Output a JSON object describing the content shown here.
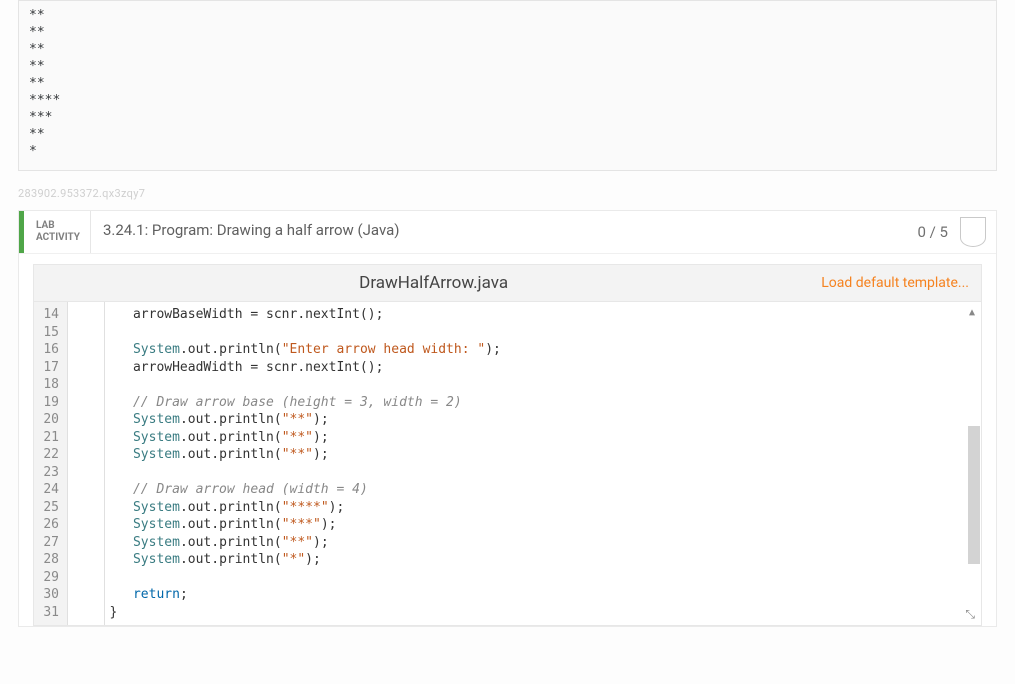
{
  "output": [
    "**",
    "**",
    "**",
    "**",
    "**",
    "****",
    "***",
    "**",
    "*"
  ],
  "hash": "283902.953372.qx3zqy7",
  "lab": {
    "tag_line1": "LAB",
    "tag_line2": "ACTIVITY",
    "title": "3.24.1: Program: Drawing a half arrow (Java)",
    "score": "0 / 5"
  },
  "editor": {
    "filename": "DrawHalfArrow.java",
    "load_template": "Load default template...",
    "first_line_number": 14,
    "lines": [
      {
        "n": 14,
        "html": "      arrowBaseWidth = scnr.nextInt();"
      },
      {
        "n": 15,
        "html": ""
      },
      {
        "n": 16,
        "html": "      <span class='cls'>System</span>.out.println(<span class='str'>\"Enter arrow head width: \"</span>);"
      },
      {
        "n": 17,
        "html": "      arrowHeadWidth = scnr.nextInt();"
      },
      {
        "n": 18,
        "html": ""
      },
      {
        "n": 19,
        "html": "      <span class='cmt'>// Draw arrow base (height = 3, width = 2)</span>"
      },
      {
        "n": 20,
        "html": "      <span class='cls'>System</span>.out.println(<span class='str'>\"**\"</span>);"
      },
      {
        "n": 21,
        "html": "      <span class='cls'>System</span>.out.println(<span class='str'>\"**\"</span>);"
      },
      {
        "n": 22,
        "html": "      <span class='cls'>System</span>.out.println(<span class='str'>\"**\"</span>);"
      },
      {
        "n": 23,
        "html": ""
      },
      {
        "n": 24,
        "html": "      <span class='cmt'>// Draw arrow head (width = 4)</span>"
      },
      {
        "n": 25,
        "html": "      <span class='cls'>System</span>.out.println(<span class='str'>\"****\"</span>);"
      },
      {
        "n": 26,
        "html": "      <span class='cls'>System</span>.out.println(<span class='str'>\"***\"</span>);"
      },
      {
        "n": 27,
        "html": "      <span class='cls'>System</span>.out.println(<span class='str'>\"**\"</span>);"
      },
      {
        "n": 28,
        "html": "      <span class='cls'>System</span>.out.println(<span class='str'>\"*\"</span>);"
      },
      {
        "n": 29,
        "html": ""
      },
      {
        "n": 30,
        "html": "      <span class='kw'>return</span>;"
      },
      {
        "n": 31,
        "html": "   }"
      }
    ]
  }
}
